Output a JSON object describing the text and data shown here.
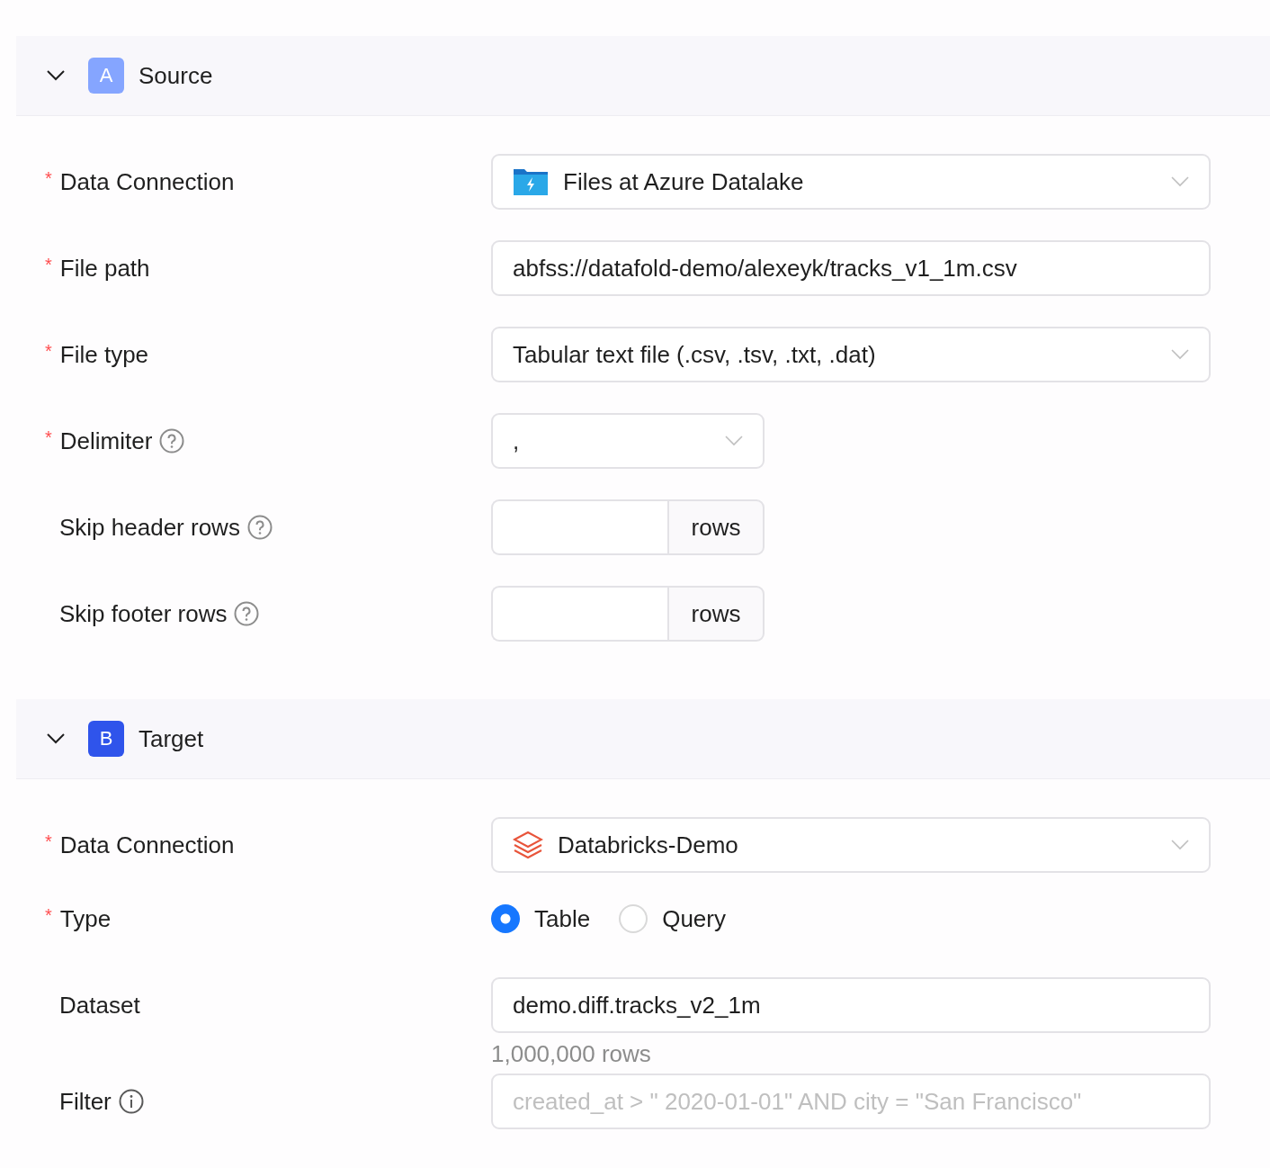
{
  "sections": [
    {
      "badge": "A",
      "color": "#85a5ff",
      "title": "Source",
      "expanded": true,
      "fields": [
        {
          "kind": "select",
          "label": "Data Connection",
          "required_mark": "*",
          "value": "Files at Azure Datalake",
          "with_icon": true
        },
        {
          "kind": "input",
          "label": "File path",
          "required_mark": "*",
          "value": "abfss://datafold-demo/alexeyk/tracks_v1_1m.csv"
        },
        {
          "kind": "select",
          "label": "File type",
          "required_mark": "*",
          "value": "Tabular text file (.csv, .tsv, .txt, .dat)"
        },
        {
          "kind": "short-select",
          "label": "Delimiter",
          "required_mark": "*",
          "help_tip": true,
          "value": ","
        },
        {
          "kind": "number-addon",
          "label": "Skip header rows",
          "help_tip": true,
          "addon": "rows"
        },
        {
          "kind": "number-addon",
          "label": "Skip footer rows",
          "help_tip": true,
          "addon": "rows"
        }
      ]
    },
    {
      "badge": "B",
      "color": "#2f54eb",
      "title": "Target",
      "expanded": true,
      "fields": [
        {
          "kind": "select",
          "label": "Data Connection",
          "required_mark": "*",
          "value": "Databricks-Demo",
          "with_icon": true
        },
        {
          "kind": "radio",
          "label": "Type",
          "required_mark": "*",
          "options": [
            {
              "label": "Table",
              "selected": true
            },
            {
              "label": "Query",
              "selected": false
            }
          ]
        },
        {
          "kind": "input",
          "label": "Dataset",
          "value": "demo.diff.tracks_v2_1m",
          "hint": "1,000,000 rows"
        },
        {
          "kind": "input",
          "label": "Filter",
          "info_tip": true,
          "placeholder": "created_at > \" 2020-01-01\" AND city = \"San Francisco\""
        }
      ]
    }
  ]
}
